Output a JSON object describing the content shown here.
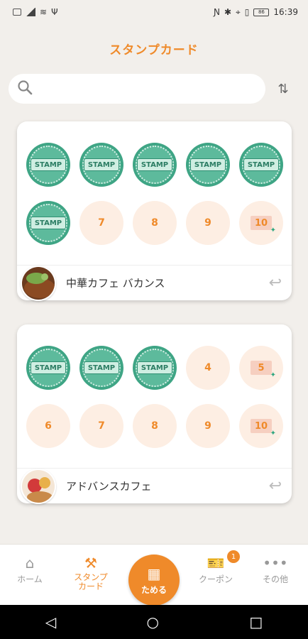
{
  "status": {
    "time": "16:39",
    "battery": "86"
  },
  "title": "スタンプカード",
  "search": {
    "value": "",
    "placeholder": ""
  },
  "cards": [
    {
      "shop": "中華カフェ バカンス",
      "stamps_collected": 6,
      "slots": [
        "STAMP",
        "STAMP",
        "STAMP",
        "STAMP",
        "STAMP",
        "STAMP",
        "7",
        "8",
        "9",
        "10"
      ]
    },
    {
      "shop": "アドバンスカフェ",
      "stamps_collected": 3,
      "slots": [
        "STAMP",
        "STAMP",
        "STAMP",
        "4",
        "5",
        "6",
        "7",
        "8",
        "9",
        "10"
      ]
    }
  ],
  "nav": {
    "home": "ホーム",
    "stamp_card": "スタンプ\nカード",
    "collect": "ためる",
    "coupon": "クーポン",
    "coupon_badge": "1",
    "other": "その他"
  },
  "colors": {
    "accent": "#ef8a2a",
    "stamp_green": "#3fa585",
    "empty_slot": "#fdeee3"
  }
}
